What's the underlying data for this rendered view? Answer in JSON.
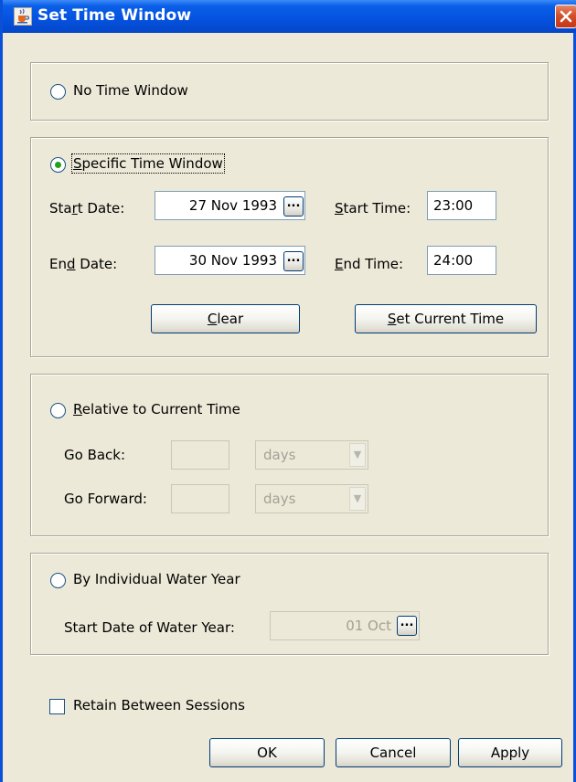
{
  "window": {
    "title": "Set Time Window",
    "icon": "java-cup-icon",
    "close_icon": "close-icon"
  },
  "no_time_window": {
    "label": "No Time Window",
    "selected": false
  },
  "specific": {
    "label": "Specific Time Window",
    "selected": true,
    "start_date_label": "Start Date:",
    "start_date_value": "27 Nov 1993",
    "end_date_label": "End Date:",
    "end_date_value": "30 Nov 1993",
    "start_time_label": "Start Time:",
    "start_time_value": "23:00",
    "end_time_label": "End Time:",
    "end_time_value": "24:00",
    "picker_label": "...",
    "clear_label": "Clear",
    "set_current_label": "Set Current Time"
  },
  "relative": {
    "label": "Relative to Current Time",
    "selected": false,
    "go_back_label": "Go Back:",
    "go_back_value": "",
    "go_back_unit": "days",
    "go_forward_label": "Go Forward:",
    "go_forward_value": "",
    "go_forward_unit": "days"
  },
  "water_year": {
    "label": "By Individual Water Year",
    "selected": false,
    "start_label": "Start Date of Water Year:",
    "start_value": "01 Oct",
    "picker_label": "..."
  },
  "retain": {
    "label": "Retain Between Sessions",
    "checked": false
  },
  "footer": {
    "ok_label": "OK",
    "cancel_label": "Cancel",
    "apply_label": "Apply"
  },
  "colors": {
    "titlebar": "#0553e0",
    "dialog_bg": "#ece9d8",
    "radio_selected": "#21a121",
    "disabled_text": "#a3a196"
  }
}
